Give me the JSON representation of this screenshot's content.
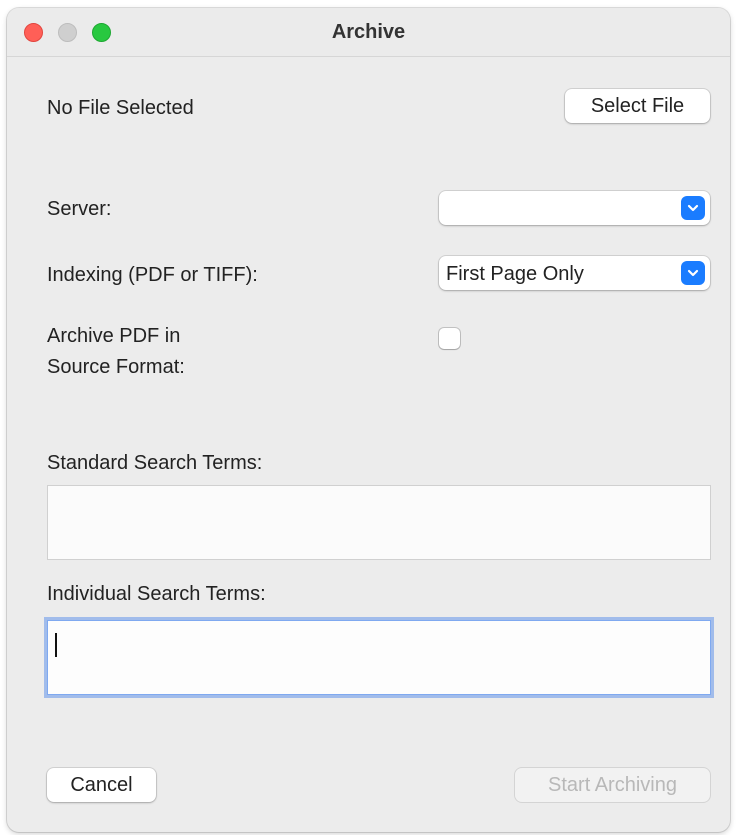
{
  "window": {
    "title": "Archive"
  },
  "file": {
    "status": "No File Selected",
    "select_button": "Select File"
  },
  "server": {
    "label": "Server:",
    "value": ""
  },
  "indexing": {
    "label": "Indexing (PDF or TIFF):",
    "value": "First Page Only"
  },
  "archive_pdf": {
    "label_line1": "Archive PDF in",
    "label_line2": "Source Format:",
    "checked": false
  },
  "standard_terms": {
    "label": "Standard Search Terms:",
    "value": ""
  },
  "individual_terms": {
    "label": "Individual Search Terms:",
    "value": ""
  },
  "buttons": {
    "cancel": "Cancel",
    "start": "Start Archiving"
  },
  "colors": {
    "accent": "#1a7cff",
    "close": "#ff5f57",
    "maximize": "#28c840",
    "focus_ring": "#7fa9f0"
  }
}
